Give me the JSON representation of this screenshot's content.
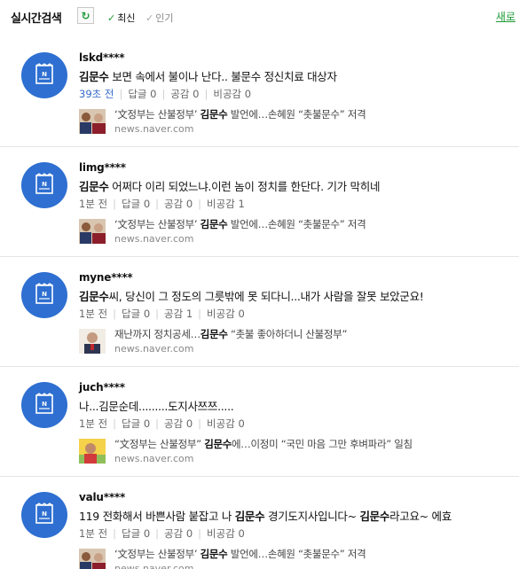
{
  "header": {
    "title": "실시간검색",
    "refresh_icon": "refresh-icon",
    "sort_latest": "최신",
    "sort_popular": "인기",
    "new_link": "새로",
    "accent_color": "#1f9a37"
  },
  "avatar_color": "#2e6fd1",
  "items": [
    {
      "user": "lskd****",
      "comment_html": "<b>김문수</b> 보면 속에서 불이나 난다.. 불문수 정신치료 대상자",
      "time": "39초 전",
      "reply": "답글 0",
      "like": "공감 0",
      "dislike": "비공감 0",
      "article_html": "‘文정부는 산불정부’ <b>김문수</b> 발언에…손혜원 “촛불문수” 저격",
      "source": "news.naver.com"
    },
    {
      "user": "limg****",
      "comment_html": "<b>김문수</b> 어쩌다 이리 되었느냐.이런 놈이 정치를 한단다. 기가 막히네",
      "time": "1분 전",
      "reply": "답글 0",
      "like": "공감 0",
      "dislike": "비공감 1",
      "article_html": "‘文정부는 산불정부’ <b>김문수</b> 발언에…손혜원 “촛불문수” 저격",
      "source": "news.naver.com"
    },
    {
      "user": "myne****",
      "comment_html": "<b>김문수</b>씨, 당신이 그 정도의 그릇밖에 못 되다니...내가 사람을 잘못 보았군요!",
      "time": "1분 전",
      "reply": "답글 0",
      "like": "공감 1",
      "dislike": "비공감 0",
      "article_html": "재난까지 정치공세…<b>김문수</b> “촛불 좋아하더니 산불정부”",
      "source": "news.naver.com"
    },
    {
      "user": "juch****",
      "comment_html": "나...김문순데.........도지사쯔쯔.....",
      "time": "1분 전",
      "reply": "답글 0",
      "like": "공감 0",
      "dislike": "비공감 0",
      "article_html": "“文정부는 산불정부” <b>김문수</b>에…이정미 “국민 마음 그만 후벼파라” 일침",
      "source": "news.naver.com"
    },
    {
      "user": "valu****",
      "comment_html": "119 전화해서 바쁜사람 붙잡고 나 <b>김문수</b> 경기도지사입니다~ <b>김문수</b>라고요~ 에효",
      "time": "1분 전",
      "reply": "답글 0",
      "like": "공감 0",
      "dislike": "비공감 0",
      "article_html": "‘文정부는 산불정부’ <b>김문수</b> 발언에…손혜원 “촛불문수” 저격",
      "source": "news.naver.com"
    }
  ]
}
